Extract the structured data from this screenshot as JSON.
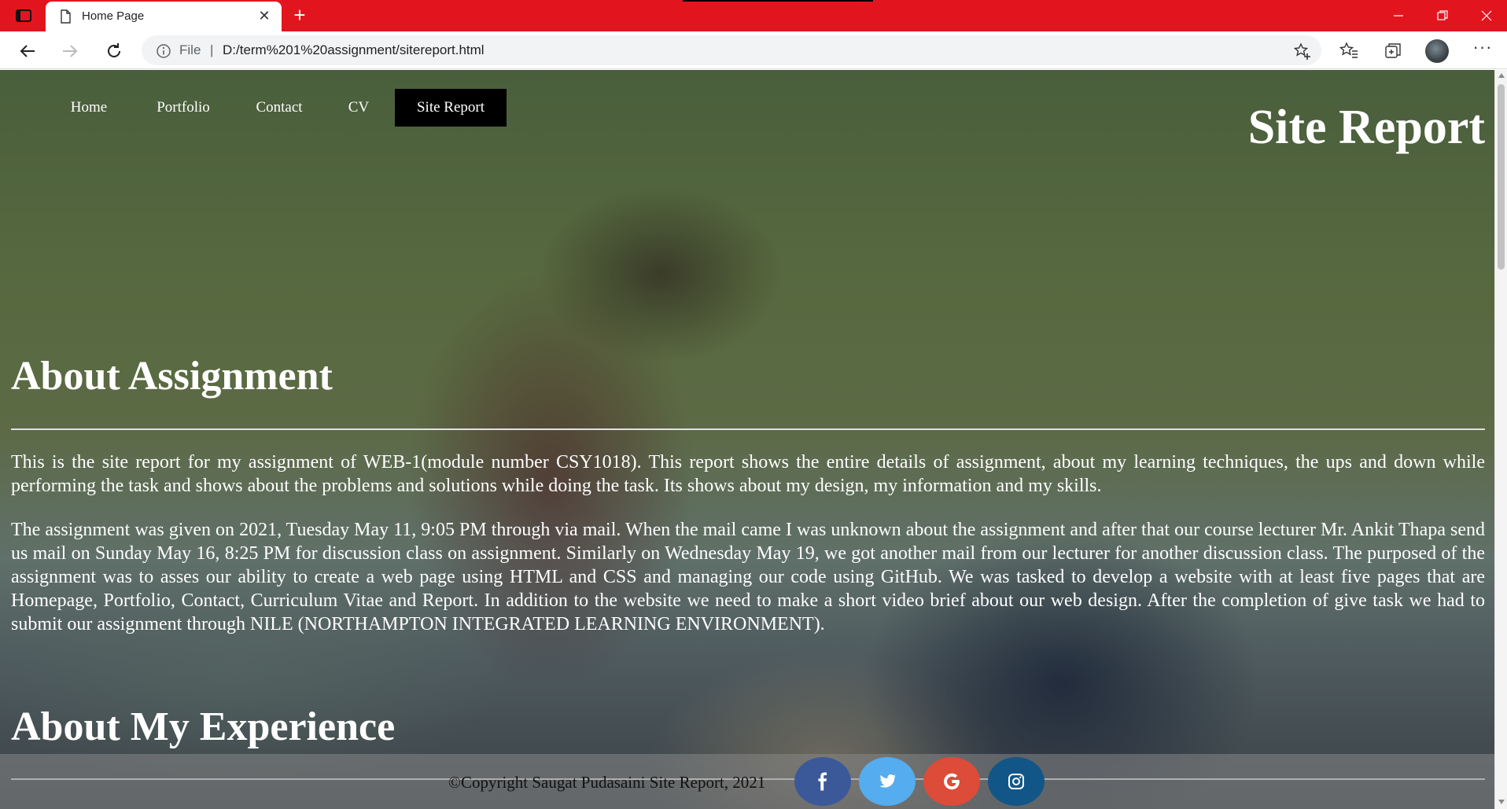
{
  "browser": {
    "tab_title": "Home Page",
    "address_scheme": "File",
    "address_separator": "|",
    "url": "D:/term%201%20assignment/sitereport.html",
    "accent_color": "#e2151f"
  },
  "site": {
    "nav": [
      "Home",
      "Portfolio",
      "Contact",
      "CV",
      "Site Report"
    ],
    "active_nav": "Site Report",
    "page_heading": "Site Report",
    "sections": [
      {
        "heading": "About Assignment",
        "paragraphs": [
          "This is the site report for my assignment of WEB-1(module number CSY1018). This report shows the entire details of assignment, about my learning techniques, the ups and down while performing the task and shows about the problems and solutions while doing the task. Its shows about my design, my information and my skills.",
          "The assignment was given on 2021, Tuesday May 11, 9:05 PM through via mail. When the mail came I was unknown about the assignment and after that our course lecturer Mr. Ankit Thapa send us mail on Sunday May 16, 8:25 PM for discussion class on assignment. Similarly on Wednesday May 19, we got another mail from our lecturer for another discussion class. The purposed of the assignment was to asses our ability to create a web page using HTML and CSS and managing our code using GitHub. We was tasked to develop a website with at least five pages that are Homepage, Portfolio, Contact, Curriculum Vitae and Report. In addition to the website we need to make a short video brief about our web design. After the completion of give task we had to submit our assignment through NILE (NORTHAMPTON INTEGRATED LEARNING ENVIRONMENT)."
        ]
      },
      {
        "heading": "About My Experience",
        "paragraphs": []
      }
    ],
    "footer_copyright": "©Copyright Saugat Pudasaini Site Report, 2021",
    "social": [
      {
        "icon": "facebook-icon",
        "color": "#3b5998"
      },
      {
        "icon": "twitter-icon",
        "color": "#55acee"
      },
      {
        "icon": "google-icon",
        "color": "#dd4b39"
      },
      {
        "icon": "instagram-icon",
        "color": "#125688"
      }
    ]
  }
}
